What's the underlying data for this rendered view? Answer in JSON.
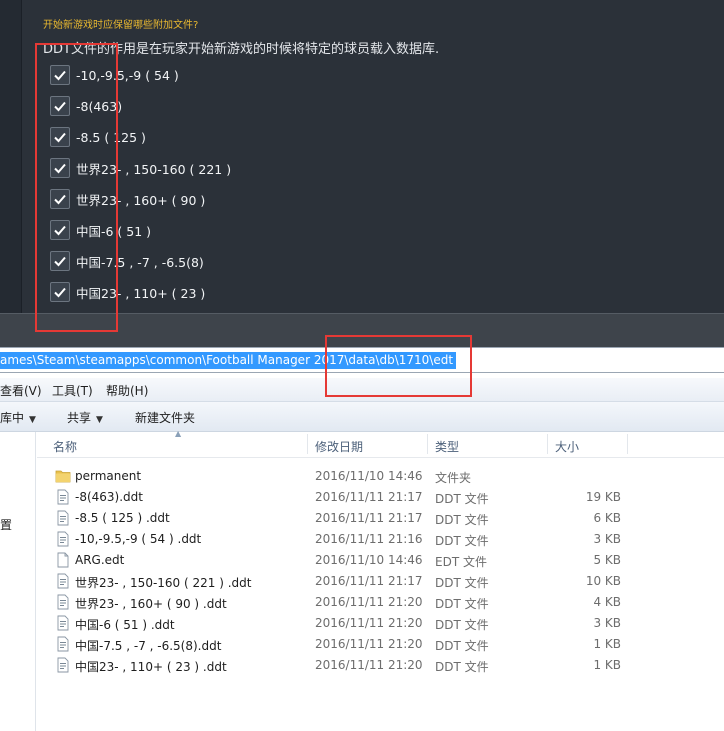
{
  "game_dialog": {
    "question": "开始新游戏时应保留哪些附加文件?",
    "description": "DDT文件的作用是在玩家开始新游戏的时候将特定的球员载入数据库.",
    "options": [
      {
        "label": "-10,-9.5,-9 ( 54 )",
        "checked": true
      },
      {
        "label": "-8(463)",
        "checked": true
      },
      {
        "label": "-8.5 ( 125 )",
        "checked": true
      },
      {
        "label": "世界23- , 150-160 ( 221 )",
        "checked": true
      },
      {
        "label": "世界23- , 160+ ( 90 )",
        "checked": true
      },
      {
        "label": "中国-6 ( 51 )",
        "checked": true
      },
      {
        "label": "中国-7.5 , -7 , -6.5(8)",
        "checked": true
      },
      {
        "label": "中国23- , 110+ ( 23 )",
        "checked": true
      }
    ]
  },
  "explorer": {
    "address_path": "ames\\Steam\\steamapps\\common\\Football Manager 2017\\data\\db\\1710\\edt",
    "menu": [
      "查看(V)",
      "工具(T)",
      "帮助(H)"
    ],
    "toolbar": {
      "library": "库中",
      "share": "共享",
      "new_folder": "新建文件夹"
    },
    "nav_text": "置",
    "columns": {
      "name": "名称",
      "date": "修改日期",
      "type": "类型",
      "size": "大小"
    },
    "files": [
      {
        "icon": "folder-icon",
        "name": "permanent",
        "date": "2016/11/10 14:46",
        "type": "文件夹",
        "size": ""
      },
      {
        "icon": "file-icon",
        "name": "-8(463).ddt",
        "date": "2016/11/11 21:17",
        "type": "DDT 文件",
        "size": "19 KB"
      },
      {
        "icon": "file-icon",
        "name": "-8.5 ( 125 ) .ddt",
        "date": "2016/11/11 21:17",
        "type": "DDT 文件",
        "size": "6 KB"
      },
      {
        "icon": "file-icon",
        "name": "-10,-9.5,-9 ( 54 ) .ddt",
        "date": "2016/11/11 21:16",
        "type": "DDT 文件",
        "size": "3 KB"
      },
      {
        "icon": "blank-file-icon",
        "name": "ARG.edt",
        "date": "2016/11/10 14:46",
        "type": "EDT 文件",
        "size": "5 KB"
      },
      {
        "icon": "file-icon",
        "name": "世界23- , 150-160 ( 221 ) .ddt",
        "date": "2016/11/11 21:17",
        "type": "DDT 文件",
        "size": "10 KB"
      },
      {
        "icon": "file-icon",
        "name": "世界23- , 160+ ( 90 ) .ddt",
        "date": "2016/11/11 21:20",
        "type": "DDT 文件",
        "size": "4 KB"
      },
      {
        "icon": "file-icon",
        "name": "中国-6 ( 51 ) .ddt",
        "date": "2016/11/11 21:20",
        "type": "DDT 文件",
        "size": "3 KB"
      },
      {
        "icon": "file-icon",
        "name": "中国-7.5 , -7 , -6.5(8).ddt",
        "date": "2016/11/11 21:20",
        "type": "DDT 文件",
        "size": "1 KB"
      },
      {
        "icon": "file-icon",
        "name": "中国23- , 110+ ( 23 ) .ddt",
        "date": "2016/11/11 21:20",
        "type": "DDT 文件",
        "size": "1 KB"
      }
    ]
  },
  "colors": {
    "dialog_bg": "#2b3139",
    "question": "#e8b830",
    "selection": "#3399ff",
    "annotation": "#e53935"
  }
}
